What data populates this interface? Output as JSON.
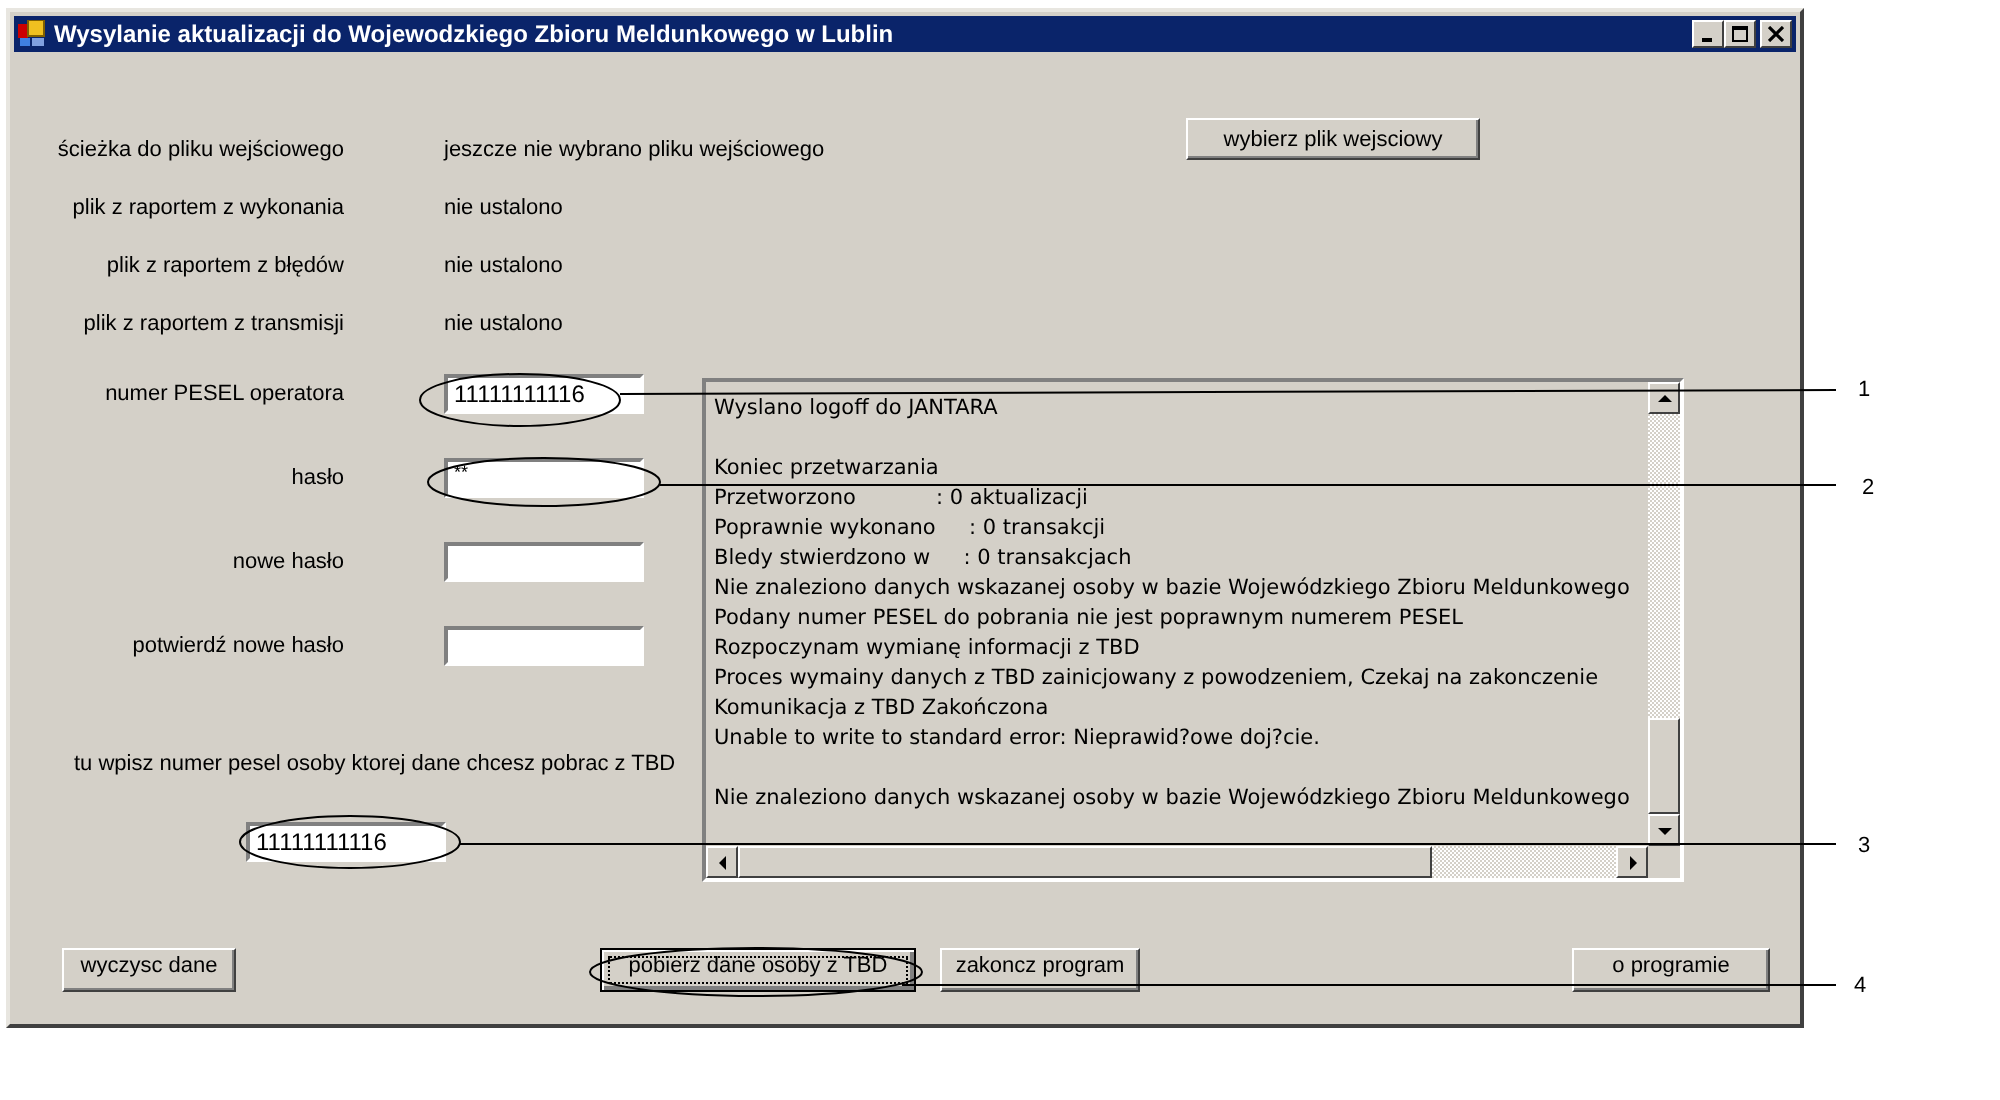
{
  "window": {
    "title": "Wysylanie aktualizacji do Wojewodzkiego Zbioru Meldunkowego w Lublin"
  },
  "file_info": [
    {
      "label": "ścieżka do pliku wejściowego",
      "value": "jeszcze nie wybrano pliku wejściowego"
    },
    {
      "label": "plik z raportem z wykonania",
      "value": "nie ustalono"
    },
    {
      "label": "plik z raportem z błędów",
      "value": "nie ustalono"
    },
    {
      "label": "plik z raportem z transmisji",
      "value": "nie ustalono"
    }
  ],
  "choose_file_button": "wybierz plik wejsciowy",
  "credentials": [
    {
      "label": "numer PESEL operatora",
      "value": "11111111116"
    },
    {
      "label": "hasło",
      "value": "**"
    },
    {
      "label": "nowe hasło"
    },
    {
      "label": "potwierdź nowe hasło"
    }
  ],
  "lookup": {
    "label": "tu wpisz numer pesel osoby ktorej dane chcesz pobrac z TBD",
    "value": "11111111116"
  },
  "log": {
    "lines": [
      {
        "kind": "text",
        "text": "Wyslano logoff do JANTARA"
      },
      {
        "kind": "blank"
      },
      {
        "kind": "text",
        "text": "Koniec przetwarzania"
      },
      {
        "kind": "text",
        "text": "Przetworzono            : 0 aktualizacji"
      },
      {
        "kind": "text",
        "text": "Poprawnie wykonano     : 0 transakcji"
      },
      {
        "kind": "text",
        "text": "Bledy stwierdzono w     : 0 transakcjach"
      },
      {
        "kind": "text",
        "text": "Nie znaleziono danych wskazanej osoby w bazie Wojewódzkiego Zbioru Meldunkowego"
      },
      {
        "kind": "text",
        "text": "Podany numer PESEL do pobrania nie jest poprawnym numerem PESEL"
      },
      {
        "kind": "text",
        "text": "Rozpoczynam wymianę informacji z TBD"
      },
      {
        "kind": "text",
        "text": "Proces wymainy danych z TBD zainicjowany z powodzeniem, Czekaj na zakonczenie"
      },
      {
        "kind": "text",
        "text": "Komunikacja z TBD Zakończona"
      },
      {
        "kind": "text",
        "text": "Unable to write to standard error: Nieprawid?owe doj?cie."
      },
      {
        "kind": "blank"
      },
      {
        "kind": "text",
        "text": "Nie znaleziono danych wskazanej osoby w bazie Wojewódzkiego Zbioru Meldunkowego"
      }
    ]
  },
  "buttons": [
    {
      "label": "wyczysc dane",
      "focused": false
    },
    {
      "label": "pobierz dane osoby z TBD",
      "focused": true
    },
    {
      "label": "zakoncz program",
      "focused": false
    },
    {
      "label": "o programie",
      "focused": false
    }
  ],
  "callouts": [
    {
      "number": "1"
    },
    {
      "number": "2"
    },
    {
      "number": "3"
    },
    {
      "number": "4"
    }
  ]
}
